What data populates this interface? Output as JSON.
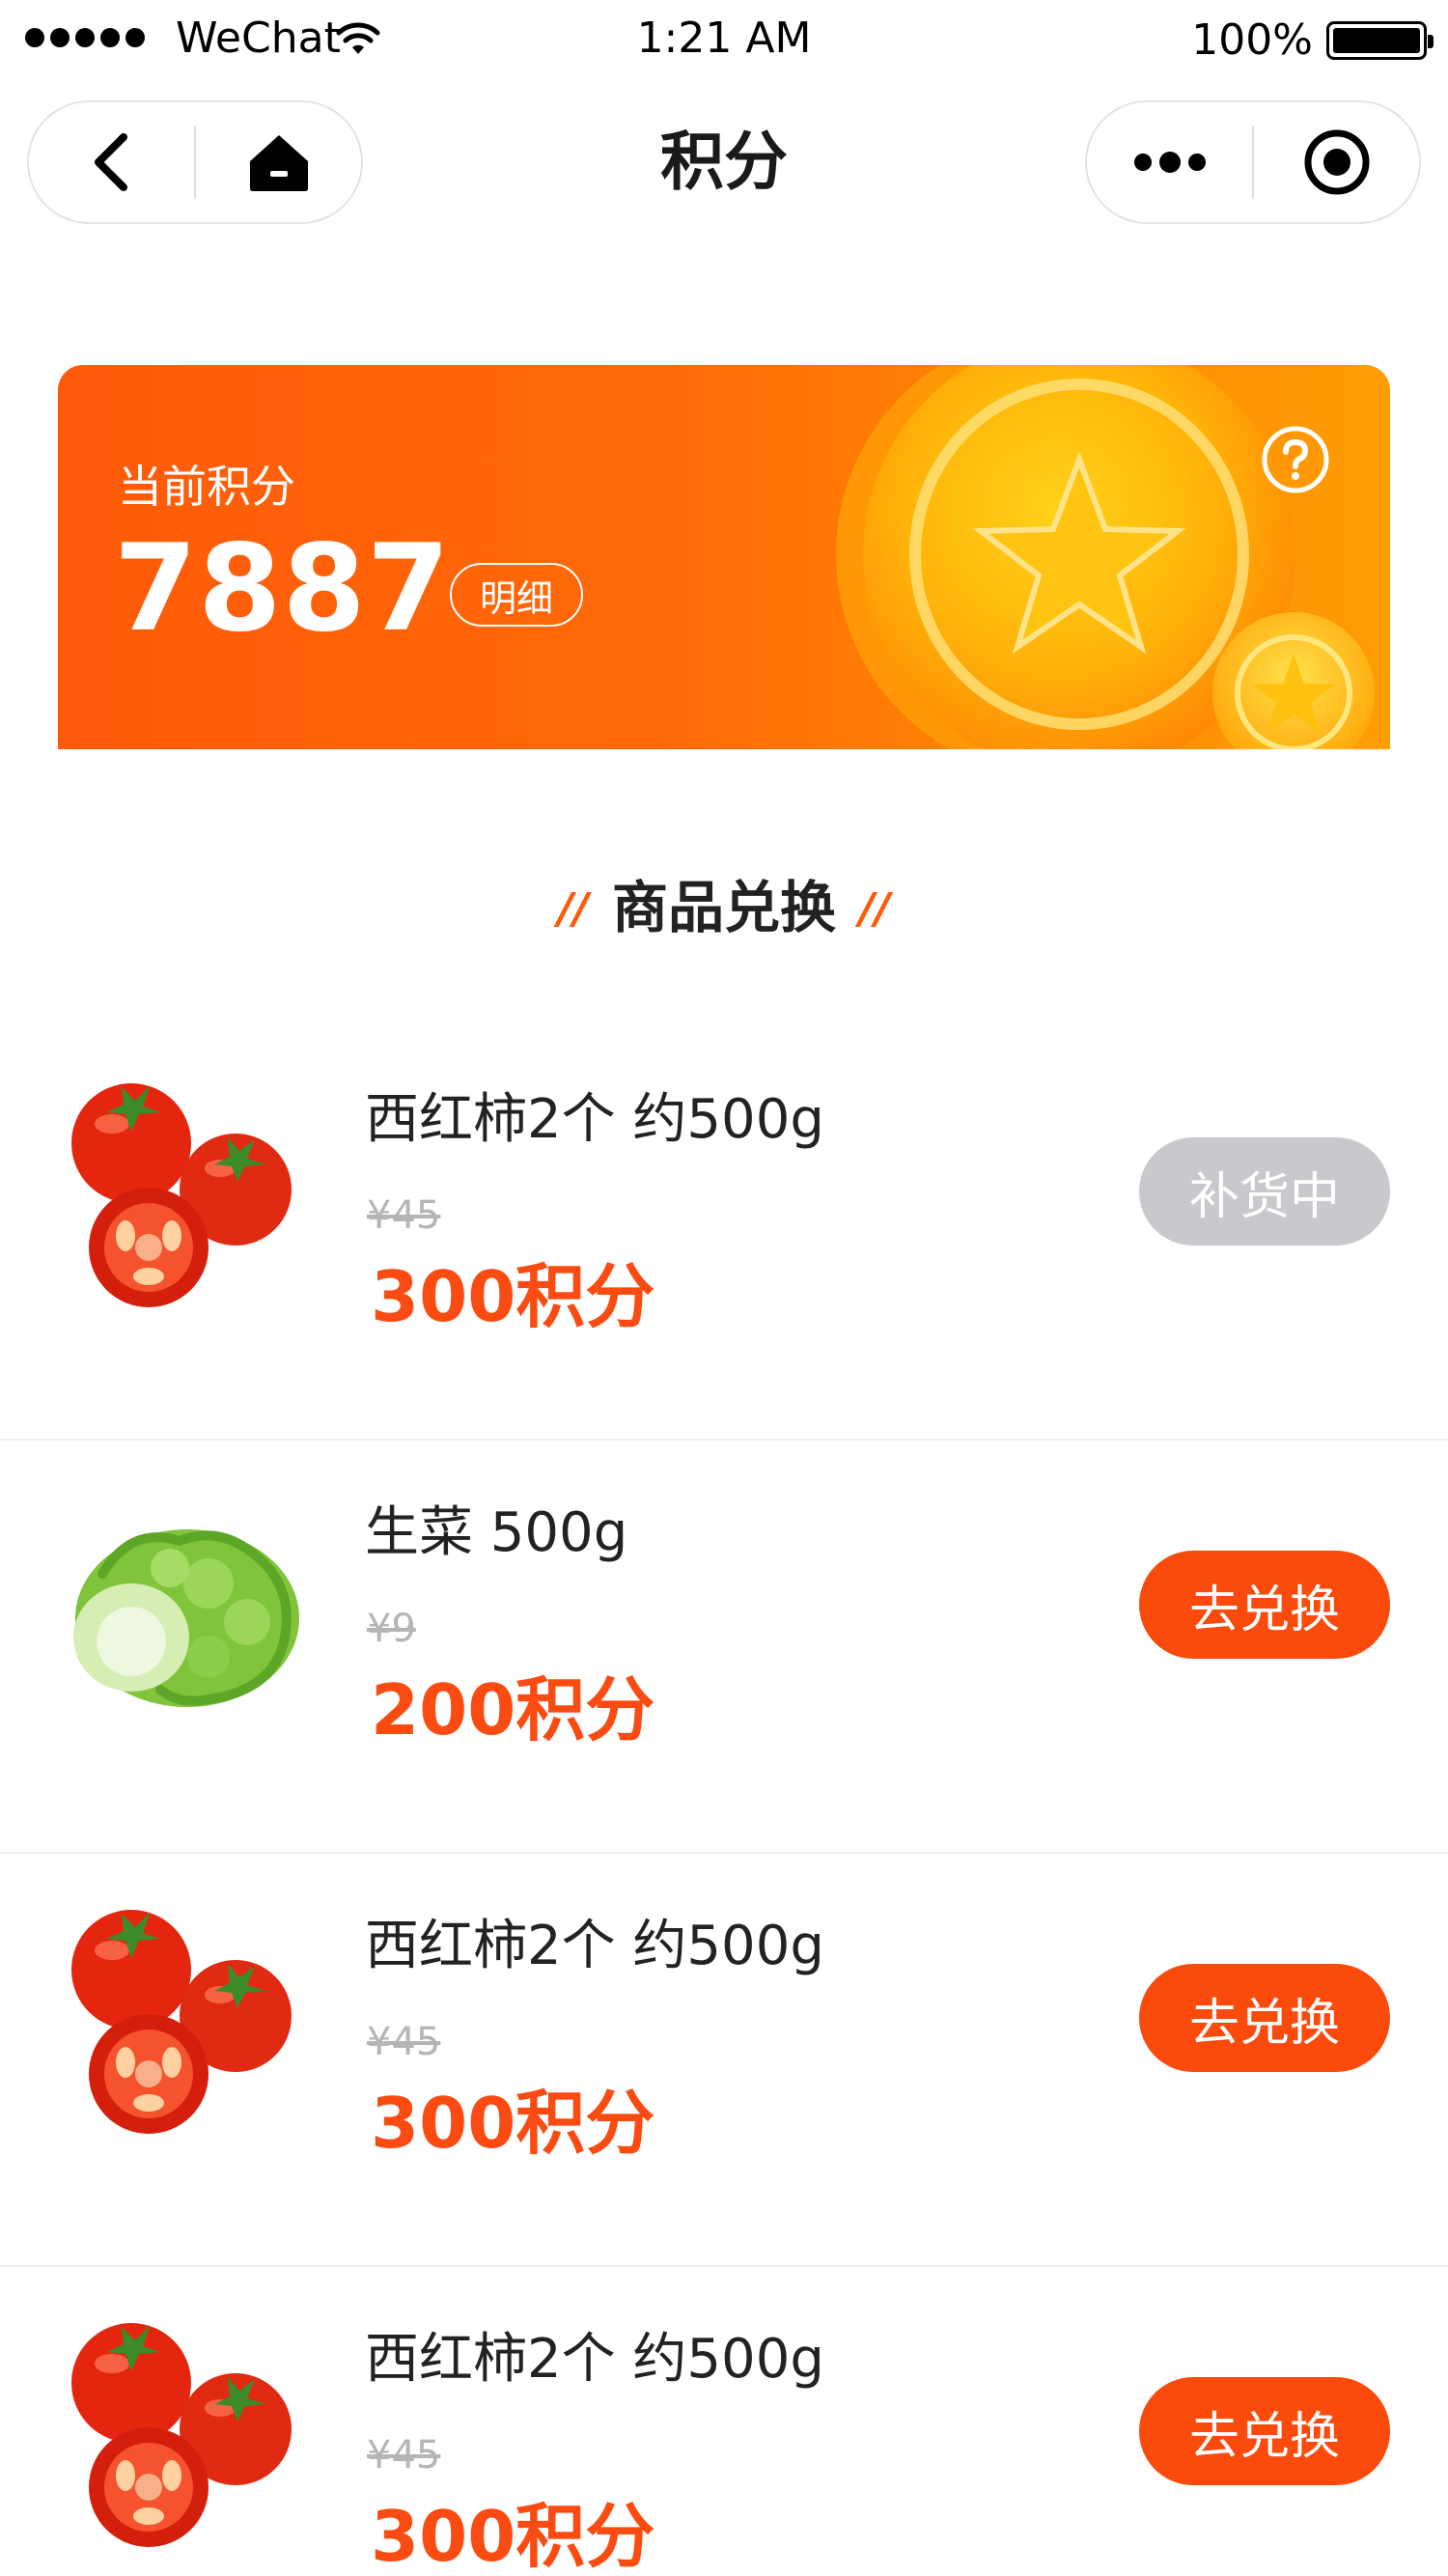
{
  "status_bar": {
    "carrier": "WeChat",
    "time": "1:21 AM",
    "battery": "100%"
  },
  "nav": {
    "title": "积分",
    "back_icon": "chevron-left-icon",
    "home_icon": "home-icon",
    "more_icon": "more-dots-icon",
    "close_icon": "target-close-icon"
  },
  "points_card": {
    "label": "当前积分",
    "value": "7887",
    "detail_label": "明细",
    "help_icon": "question-icon",
    "gradient_start": "#ff5a0a",
    "gradient_end": "#ff9d06"
  },
  "section": {
    "title": "商品兑换",
    "accent": "#ff5a0a"
  },
  "products": [
    {
      "name": "西红柿2个 约500g",
      "original_price": "¥45",
      "points": "300积分",
      "button": "补货中",
      "available": false,
      "image": "tomato"
    },
    {
      "name": "生菜 500g",
      "original_price": "¥9",
      "points": "200积分",
      "button": "去兑换",
      "available": true,
      "image": "lettuce"
    },
    {
      "name": "西红柿2个 约500g",
      "original_price": "¥45",
      "points": "300积分",
      "button": "去兑换",
      "available": true,
      "image": "tomato"
    },
    {
      "name": "西红柿2个 约500g",
      "original_price": "¥45",
      "points": "300积分",
      "button": "去兑换",
      "available": true,
      "image": "tomato"
    }
  ],
  "colors": {
    "accent": "#fa4a0c",
    "disabled": "#c8c9cc"
  }
}
